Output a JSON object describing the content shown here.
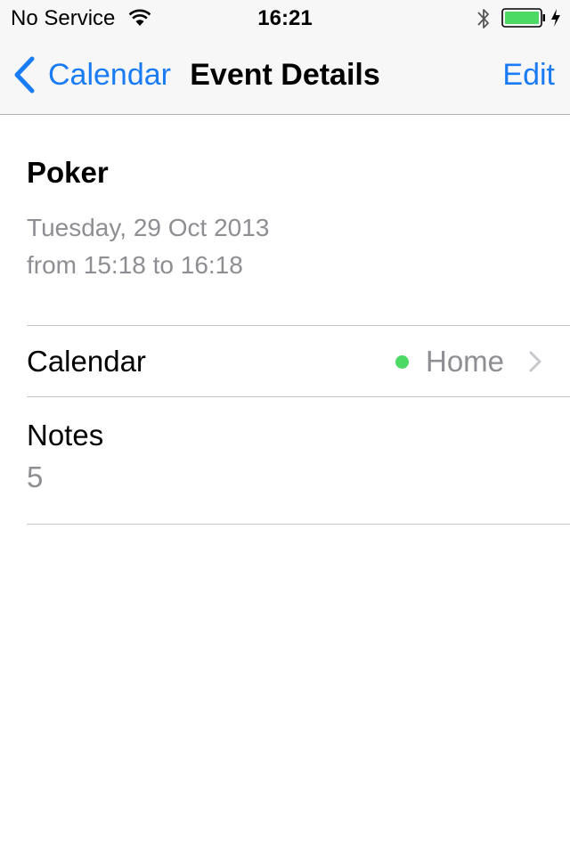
{
  "status_bar": {
    "carrier": "No Service",
    "time": "16:21",
    "wifi_icon": "wifi-icon",
    "bluetooth_icon": "bluetooth-icon",
    "battery_icon": "battery-icon",
    "battery_level": 1.0,
    "charging": true,
    "battery_color": "#4cd964"
  },
  "nav": {
    "back_label": "Calendar",
    "title": "Event Details",
    "edit_label": "Edit",
    "accent_color": "#1a7cf4"
  },
  "event": {
    "title": "Poker",
    "date": "Tuesday, 29 Oct 2013",
    "time_range": "from 15:18 to 16:18"
  },
  "calendar_row": {
    "label": "Calendar",
    "value": "Home",
    "dot_color": "#4cd964"
  },
  "notes": {
    "label": "Notes",
    "value": "5"
  }
}
